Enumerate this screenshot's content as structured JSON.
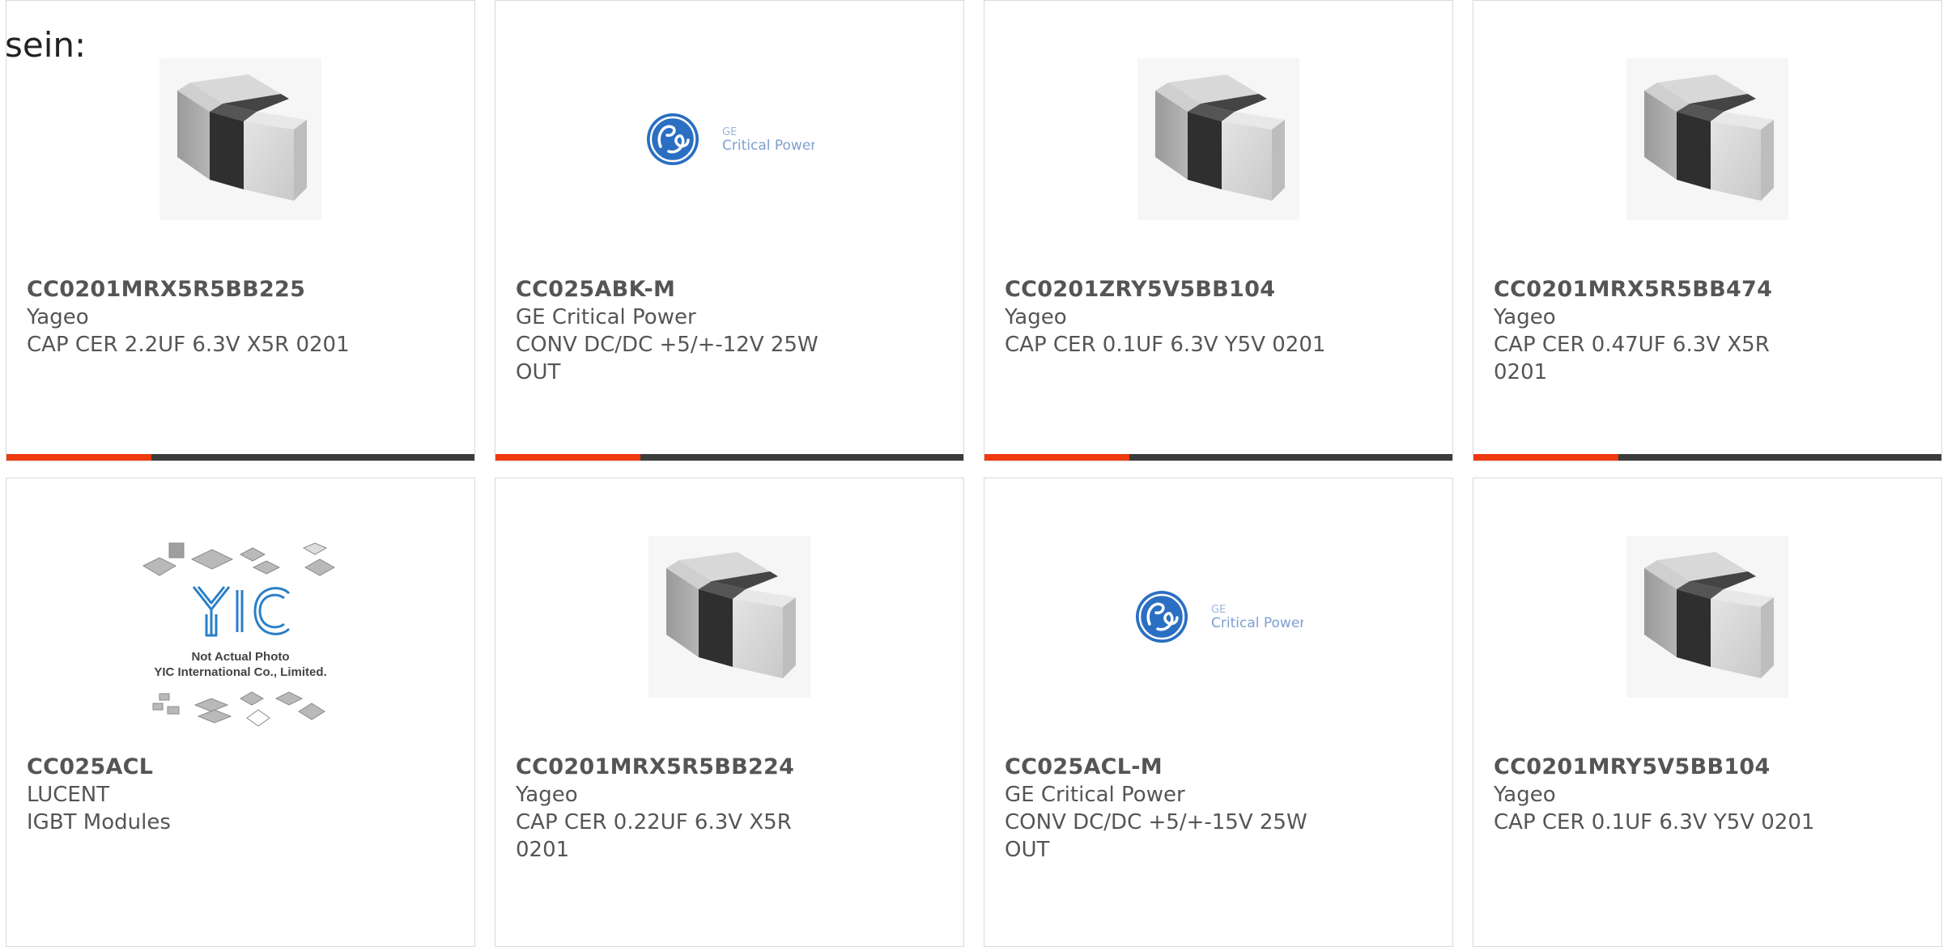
{
  "intro_text": "sein:",
  "colors": {
    "accent": "#ee3a0e",
    "bar": "#3c3c3c",
    "text": "#555555",
    "ge_blue": "#2a6fc2"
  },
  "products": [
    {
      "part_number": "CC0201MRX5R5BB225",
      "manufacturer": "Yageo",
      "description": "CAP CER 2.2UF 6.3V X5R 0201",
      "image_type": "capacitor-chip-image",
      "progress": 0.31
    },
    {
      "part_number": "CC025ABK-M",
      "manufacturer": "GE Critical Power",
      "description": "CONV DC/DC +5/+-12V 25W OUT",
      "image_type": "ge-logo-image",
      "logo_text_1": "GE",
      "logo_text_2": "Critical Power",
      "progress": 0.31
    },
    {
      "part_number": "CC0201ZRY5V5BB104",
      "manufacturer": "Yageo",
      "description": "CAP CER 0.1UF 6.3V Y5V 0201",
      "image_type": "capacitor-chip-image",
      "progress": 0.31
    },
    {
      "part_number": "CC0201MRX5R5BB474",
      "manufacturer": "Yageo",
      "description": "CAP CER 0.47UF 6.3V X5R 0201",
      "image_type": "capacitor-chip-image",
      "progress": 0.31
    },
    {
      "part_number": "CC025ACL",
      "manufacturer": "LUCENT",
      "description": "IGBT Modules",
      "image_type": "yic-placeholder-image",
      "placeholder_line_1": "Not Actual Photo",
      "placeholder_line_2": "YIC International Co., Limited."
    },
    {
      "part_number": "CC0201MRX5R5BB224",
      "manufacturer": "Yageo",
      "description": "CAP CER 0.22UF 6.3V X5R 0201",
      "image_type": "capacitor-chip-image"
    },
    {
      "part_number": "CC025ACL-M",
      "manufacturer": "GE Critical Power",
      "description": "CONV DC/DC +5/+-15V 25W OUT",
      "image_type": "ge-logo-image",
      "logo_text_1": "GE",
      "logo_text_2": "Critical Power"
    },
    {
      "part_number": "CC0201MRY5V5BB104",
      "manufacturer": "Yageo",
      "description": "CAP CER 0.1UF 6.3V Y5V 0201",
      "image_type": "capacitor-chip-image"
    }
  ]
}
